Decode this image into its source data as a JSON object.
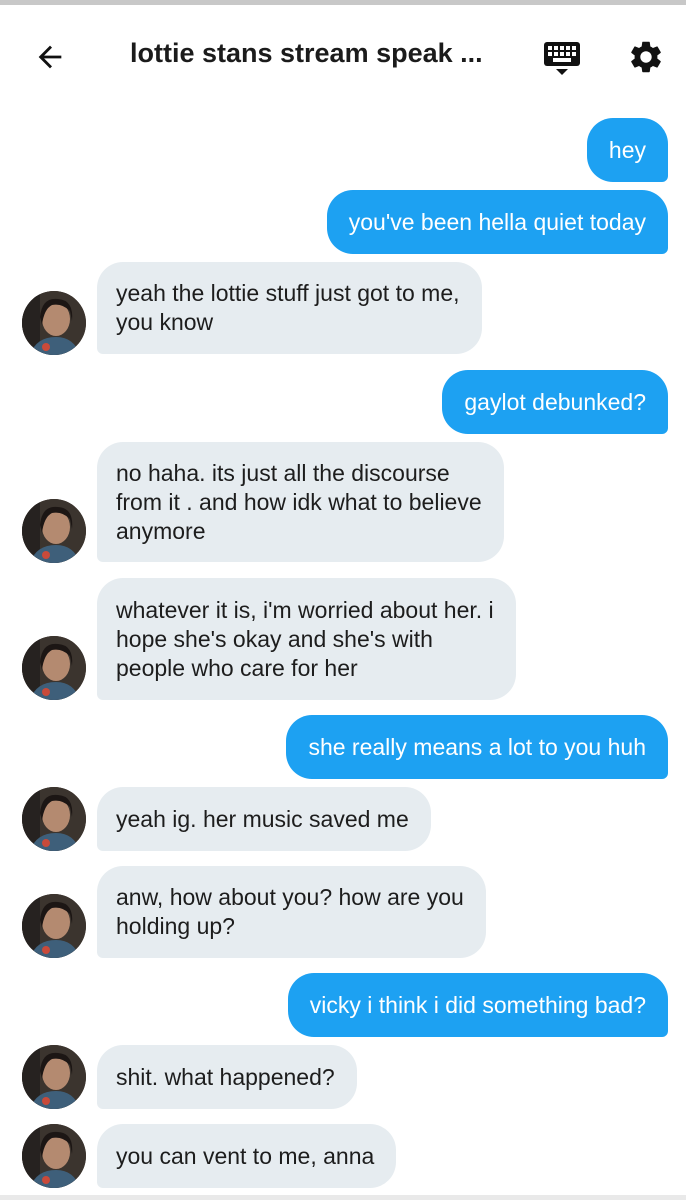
{
  "header": {
    "title": "lottie stans stream speak ...",
    "back_icon": "arrow-left-icon",
    "keyboard_icon": "keyboard-icon",
    "settings_icon": "gear-icon"
  },
  "colors": {
    "outgoing_bubble": "#1da1f2",
    "incoming_bubble": "#e6ecf0",
    "outgoing_text": "#ffffff",
    "incoming_text": "#1d1d1d"
  },
  "messages": [
    {
      "direction": "outgoing",
      "text": "hey"
    },
    {
      "direction": "outgoing",
      "text": "you've been hella quiet today"
    },
    {
      "direction": "incoming",
      "text": "yeah the lottie stuff just got to me,\nyou know"
    },
    {
      "direction": "outgoing",
      "text": "gaylot debunked?"
    },
    {
      "direction": "incoming",
      "text": "no haha. its just all the discourse\nfrom it . and how idk what to believe\nanymore"
    },
    {
      "direction": "incoming",
      "text": "whatever it is, i'm worried about her. i\nhope she's okay and she's with\npeople who care for her"
    },
    {
      "direction": "outgoing",
      "text": "she really means a lot to you huh"
    },
    {
      "direction": "incoming",
      "text": "yeah ig. her music saved me"
    },
    {
      "direction": "incoming",
      "text": "anw, how about you? how are you\nholding up?"
    },
    {
      "direction": "outgoing",
      "text": "vicky i think i did something bad?"
    },
    {
      "direction": "incoming",
      "text": "shit. what happened?"
    },
    {
      "direction": "incoming",
      "text": "you can vent to me, anna"
    }
  ]
}
